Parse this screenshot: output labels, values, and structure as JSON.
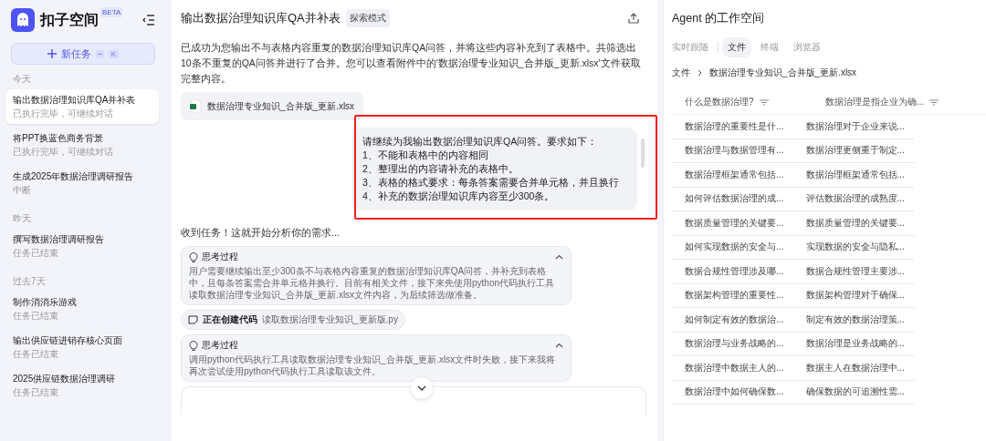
{
  "sidebar": {
    "logo_text": "扣子空间",
    "beta_badge": "BETA",
    "new_task": {
      "label": "新任务",
      "shortcut_key": "K"
    },
    "groups": [
      {
        "label": "今天",
        "items": [
          {
            "title": "输出数据治理知识库QA并补表",
            "status": "已执行完毕，可继续对话",
            "selected": true
          },
          {
            "title": "将PPT换蓝色商务背景",
            "status": "已执行完毕，可继续对话",
            "selected": false
          },
          {
            "title": "生成2025年数据治理调研报告",
            "status": "中断",
            "selected": false
          }
        ]
      },
      {
        "label": "昨天",
        "items": [
          {
            "title": "撰写数据治理调研报告",
            "status": "任务已结束",
            "selected": false
          }
        ]
      },
      {
        "label": "过去7天",
        "items": [
          {
            "title": "制作消消乐游戏",
            "status": "任务已结束",
            "selected": false
          },
          {
            "title": "输出供应链进销存核心页面",
            "status": "任务已结束",
            "selected": false
          },
          {
            "title": "2025供应链数据治理调研",
            "status": "任务已结束",
            "selected": false
          }
        ]
      }
    ]
  },
  "chat": {
    "title": "输出数据治理知识库QA并补表",
    "mode_badge": "探索模式",
    "messages": [
      {
        "kind": "assistant_text",
        "text": "已成功为您输出不与表格内容重复的数据治理知识库QA问答，并将这些内容补充到了表格中。共筛选出10条不重复的QA问答并进行了合并。您可以查看附件中的'数据治理专业知识_合并版_更新.xlsx'文件获取完整内容。"
      },
      {
        "kind": "file",
        "name": "数据治理专业知识_合并版_更新.xlsx"
      },
      {
        "kind": "user",
        "highlighted": true,
        "lines": [
          "请继续为我输出数据治理知识库QA问答。要求如下：",
          "1、不能和表格中的内容相同",
          "2、整理出的内容请补充的表格中。",
          "3、表格的格式要求：每条答案需要合并单元格，并且换行",
          "4、补充的数据治理知识库内容至少300条。"
        ]
      },
      {
        "kind": "assistant_text",
        "text": "收到任务！这就开始分析你的需求..."
      },
      {
        "kind": "thought",
        "title": "思考过程",
        "expanded": true,
        "text": "用户需要继续输出至少300条不与表格内容重复的数据治理知识库QA问答，并补充到表格中，且每条答案需合并单元格并换行。目前有相关文件，接下来先使用python代码执行工具读取数据治理专业知识_合并版_更新.xlsx文件内容，为后续筛选做准备。"
      },
      {
        "kind": "action",
        "label": "正在创建代码",
        "detail": "读取数据治理专业知识_更新版.py"
      },
      {
        "kind": "thought",
        "title": "思考过程",
        "expanded": true,
        "text": "调用python代码执行工具读取数据治理专业知识_合并版_更新.xlsx文件时失败，接下来我将再次尝试使用python代码执行工具读取该文件。"
      }
    ]
  },
  "workspace": {
    "title": "Agent 的工作空间",
    "tabs": [
      {
        "label": "实时跟随",
        "selected": false
      },
      {
        "label": "文件",
        "selected": true
      },
      {
        "label": "终端",
        "selected": false
      },
      {
        "label": "浏览器",
        "selected": false
      }
    ],
    "breadcrumb": [
      "文件",
      "数据治理专业知识_合并版_更新.xlsx"
    ],
    "table": {
      "columns": [
        "什么是数据治理?",
        "数据治理是指企业为确..."
      ],
      "rows": [
        [
          "数据治理的重要性是什...",
          "数据治理对于企业来说..."
        ],
        [
          "数据治理与数据管理有...",
          "数据治理更侧重于制定..."
        ],
        [
          "数据治理框架通常包括...",
          "数据治理框架通常包括..."
        ],
        [
          "如何评估数据治理的成...",
          "评估数据治理的成熟度..."
        ],
        [
          "数据质量管理的关键要...",
          "数据质量管理的关键要..."
        ],
        [
          "如何实现数据的安全与...",
          "实现数据的安全与隐私..."
        ],
        [
          "数据合规性管理涉及哪...",
          "数据合规性管理主要涉..."
        ],
        [
          "数据架构管理的重要性...",
          "数据架构管理对于确保..."
        ],
        [
          "如何制定有效的数据治...",
          "制定有效的数据治理策..."
        ],
        [
          "数据治理与业务战略的...",
          "数据治理是业务战略的..."
        ],
        [
          "数据治理中数据主人的...",
          "数据主人在数据治理中..."
        ],
        [
          "数据治理中如何确保数...",
          "确保数据的可追溯性需..."
        ]
      ]
    }
  }
}
